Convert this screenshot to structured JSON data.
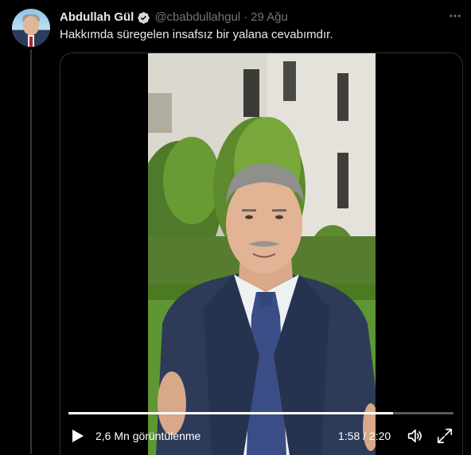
{
  "tweet": {
    "author_name": "Abdullah Gül",
    "handle": "@cbabdullahgul",
    "separator": "·",
    "date": "29 Ağu",
    "text": "Hakkımda süregelen insafsız bir yalana cevabımdır.",
    "verified_icon": "verified-badge-icon",
    "more_icon": "more-options-icon"
  },
  "video": {
    "views": "2,6 Mn görüntülenme",
    "time": "1:58 / 2:20",
    "progress_fraction": 0.843,
    "play_icon": "play-icon",
    "volume_icon": "volume-icon",
    "fullscreen_icon": "fullscreen-icon"
  },
  "colors": {
    "background": "#000000",
    "primary_text": "#e7e9ea",
    "secondary_text": "#71767b",
    "border": "#2f3336"
  }
}
